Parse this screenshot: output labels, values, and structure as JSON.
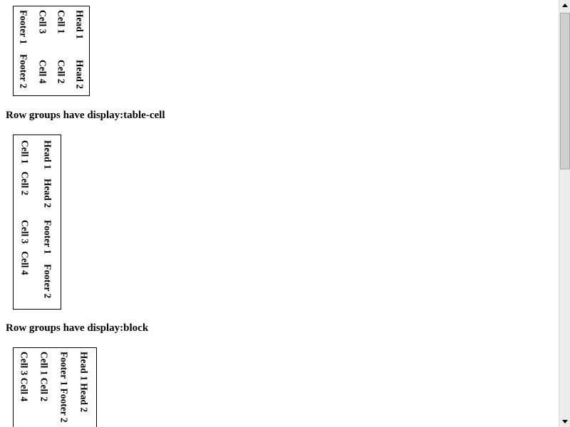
{
  "table1": {
    "head1": "Head 1",
    "head2": "Head 2",
    "cell1": "Cell 1",
    "cell2": "Cell 2",
    "cell3": "Cell 3",
    "cell4": "Cell 4",
    "footer1": "Footer 1",
    "footer2": "Footer 2"
  },
  "heading2": "Row groups have display:table-cell",
  "table2": {
    "head1": "Head 1",
    "head2": "Head 2",
    "footer1": "Footer 1",
    "footer2": "Footer 2",
    "cell1": "Cell 1",
    "cell2": "Cell 2",
    "cell3": "Cell 3",
    "cell4": "Cell 4"
  },
  "heading3": "Row groups have display:block",
  "table3": {
    "head_row": "Head 1 Head 2",
    "footer_row": "Footer 1 Footer 2",
    "cell_row1": "Cell 1 Cell 2",
    "cell_row2": "Cell 3 Cell 4"
  }
}
